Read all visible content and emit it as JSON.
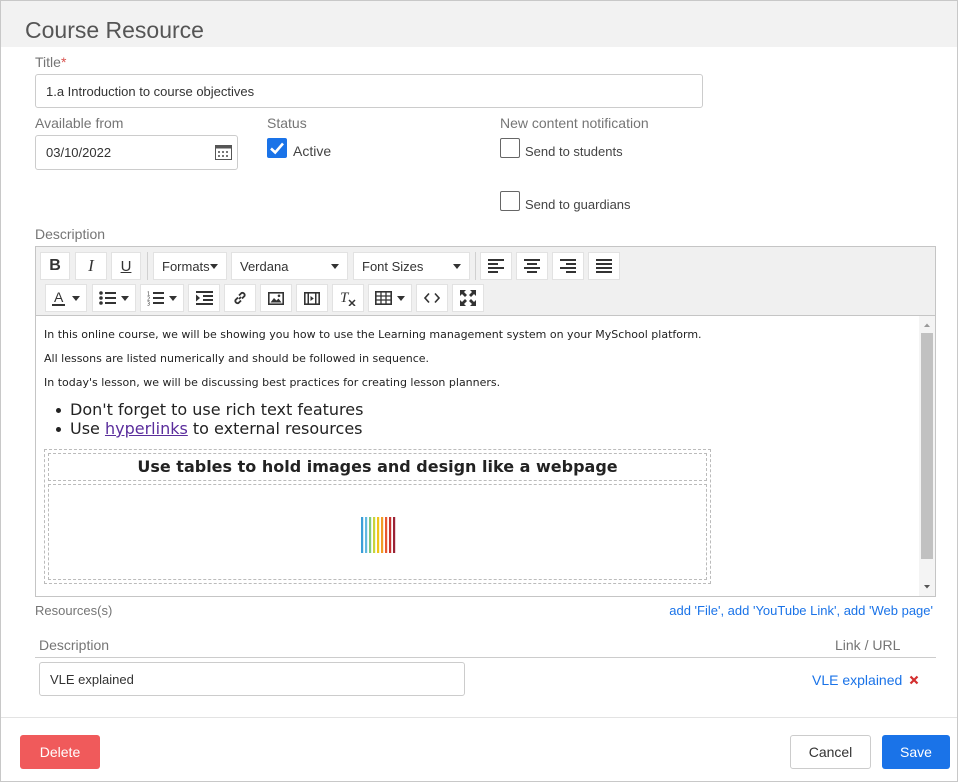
{
  "dialog": {
    "title": "Course Resource"
  },
  "form": {
    "title_label": "Title",
    "required_mark": "*",
    "title_value": "1.a Introduction to course objectives",
    "available_from_label": "Available from",
    "available_from_value": "03/10/2022",
    "status_label": "Status",
    "status_active_label": "Active",
    "status_active_checked": true,
    "notification_label": "New content notification",
    "send_students_label": "Send to students",
    "send_students_checked": false,
    "send_guardians_label": "Send to guardians",
    "send_guardians_checked": false,
    "description_label": "Description"
  },
  "toolbar": {
    "bold": "B",
    "italic": "I",
    "underline": "U",
    "formats": "Formats",
    "font": "Verdana",
    "font_sizes": "Font Sizes",
    "text_color": "A",
    "icons": [
      "bold-icon",
      "italic-icon",
      "underline-icon",
      "align-left-icon",
      "align-center-icon",
      "align-right-icon",
      "align-justify-icon",
      "text-color-icon",
      "bullet-list-icon",
      "numbered-list-icon",
      "indent-icon",
      "link-icon",
      "image-icon",
      "media-icon",
      "clear-format-icon",
      "table-icon",
      "code-icon",
      "fullscreen-icon"
    ]
  },
  "content": {
    "para1": "In this online course, we will be showing you how to use the Learning management system on your MySchool platform.",
    "para2": "All lessons are listed numerically and should be followed in sequence.",
    "para3": "In today's lesson, we will be discussing best practices for creating lesson planners.",
    "bullet1": "Don't forget to use rich text features",
    "bullet2_pre": "Use ",
    "bullet2_link": "hyperlinks",
    "bullet2_post": " to external resources",
    "table_heading": "Use tables to hold images and design like a webpage",
    "logo_colors": [
      "#3b9fd8",
      "#5fb8e0",
      "#7fc97f",
      "#c8d43a",
      "#f0c419",
      "#f29b26",
      "#e8572f",
      "#c8312f",
      "#9b2335"
    ]
  },
  "resources": {
    "label": "Resources(s)",
    "add_links": "add 'File', add 'YouTube Link', add 'Web page'",
    "col_description": "Description",
    "col_link": "Link / URL",
    "rows": [
      {
        "description": "VLE explained",
        "link": "VLE explained"
      }
    ]
  },
  "footer": {
    "delete": "Delete",
    "cancel": "Cancel",
    "save": "Save"
  },
  "colors": {
    "accent": "#1a73e8",
    "danger": "#f05a5b",
    "remove": "#d32f2f"
  }
}
